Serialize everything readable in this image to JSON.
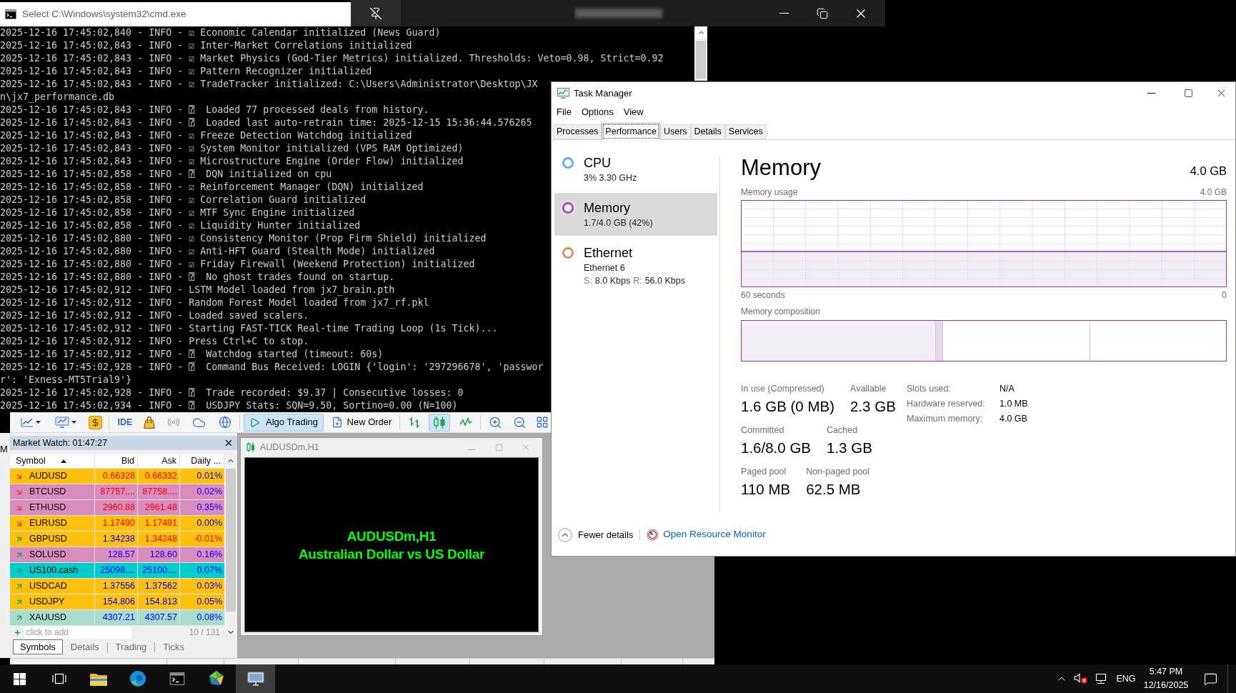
{
  "console": {
    "title": "Select C:\\Windows\\system32\\cmd.exe",
    "lines": [
      "2025-12-16 17:45:02,840 - INFO - ☑ Economic Calendar initialized (News Guard)",
      "2025-12-16 17:45:02,843 - INFO - ☑ Inter-Market Correlations initialized",
      "2025-12-16 17:45:02,843 - INFO - ☑ Market Physics (God-Tier Metrics) initialized. Thresholds: Veto=0.98, Strict=0.92",
      "2025-12-16 17:45:02,843 - INFO - ☑ Pattern Recognizer initialized",
      "2025-12-16 17:45:02,843 - INFO - ☑ TradeTracker initialized: C:\\Users\\Administrator\\Desktop\\JX",
      "n\\jx7_performance.db",
      "2025-12-16 17:45:02,843 - INFO - ⍰  Loaded 77 processed deals from history.",
      "2025-12-16 17:45:02,843 - INFO - ⍰  Loaded last auto-retrain time: 2025-12-15 15:36:44.576265",
      "2025-12-16 17:45:02,843 - INFO - ☑ Freeze Detection Watchdog initialized",
      "2025-12-16 17:45:02,843 - INFO - ☑ System Monitor initialized (VPS RAM Optimized)",
      "2025-12-16 17:45:02,843 - INFO - ☑ Microstructure Engine (Order Flow) initialized",
      "2025-12-16 17:45:02,858 - INFO - ⍰  DQN initialized on cpu",
      "2025-12-16 17:45:02,858 - INFO - ☑ Reinforcement Manager (DQN) initialized",
      "2025-12-16 17:45:02,858 - INFO - ☑ Correlation Guard initialized",
      "2025-12-16 17:45:02,858 - INFO - ☑ MTF Sync Engine initialized",
      "2025-12-16 17:45:02,858 - INFO - ☑ Liquidity Hunter initialized",
      "2025-12-16 17:45:02,880 - INFO - ☑ Consistency Monitor (Prop Firm Shield) initialized",
      "2025-12-16 17:45:02,880 - INFO - ☑ Anti-HFT Guard (Stealth Mode) initialized",
      "2025-12-16 17:45:02,880 - INFO - ☑ Friday Firewall (Weekend Protection) initialized",
      "2025-12-16 17:45:02,880 - INFO - ⍰  No ghost trades found on startup.",
      "2025-12-16 17:45:02,912 - INFO - LSTM Model loaded from jx7_brain.pth",
      "2025-12-16 17:45:02,912 - INFO - Random Forest Model loaded from jx7_rf.pkl",
      "2025-12-16 17:45:02,912 - INFO - Loaded saved scalers.",
      "2025-12-16 17:45:02,912 - INFO - Starting FAST-TICK Real-time Trading Loop (1s Tick)...",
      "2025-12-16 17:45:02,912 - INFO - Press Ctrl+C to stop.",
      "2025-12-16 17:45:02,912 - INFO - ⍰  Watchdog started (timeout: 60s)",
      "2025-12-16 17:45:02,928 - INFO - ⍰  Command Bus Received: LOGIN {'login': '297296678', 'passwor",
      "r': 'Exness-MT5Trial9'}",
      "2025-12-16 17:45:02,928 - INFO - ⍰  Trade recorded: $9.37 | Consecutive losses: 0",
      "2025-12-16 17:45:02,934 - INFO - ⍰  USDJPY Stats: SQN=9.50, Sortino=0.00 (N=100)"
    ]
  },
  "side_panel": {
    "text": "M"
  },
  "mt5": {
    "toolbar": {
      "ide": "IDE",
      "algo_trading": {
        "label": "Algo Trading",
        "on": true
      },
      "new_order": "New Order",
      "chart_types": [
        {
          "kind": "bars",
          "selected": false
        },
        {
          "kind": "candles",
          "selected": true
        },
        {
          "kind": "line",
          "selected": false
        }
      ]
    },
    "market_watch": {
      "title": "Market Watch: 01:47:27",
      "columns": [
        {
          "label": "Symbol",
          "sorted": true
        },
        {
          "label": "Bid",
          "sorted": false
        },
        {
          "label": "Ask",
          "sorted": false
        },
        {
          "label": "Daily ...",
          "sorted": false
        }
      ],
      "rows": [
        {
          "symbol": "AUDUSD",
          "rising": false,
          "bid": "0.66328",
          "bid_rising": false,
          "ask": "0.66332",
          "ask_rising": false,
          "daily": "0.01%",
          "daily_rising": true,
          "color": "#ffc10e"
        },
        {
          "symbol": "BTCUSD",
          "rising": false,
          "bid": "87757....",
          "bid_rising": false,
          "ask": "87758....",
          "ask_rising": false,
          "daily": "0.02%",
          "daily_rising": true,
          "color": "#da8cbe"
        },
        {
          "symbol": "ETHUSD",
          "rising": false,
          "bid": "2960.88",
          "bid_rising": false,
          "ask": "2961.48",
          "ask_rising": false,
          "daily": "0.35%",
          "daily_rising": true,
          "color": "#da8cbe"
        },
        {
          "symbol": "EURUSD",
          "rising": false,
          "bid": "1.17490",
          "bid_rising": false,
          "ask": "1.17491",
          "ask_rising": false,
          "daily": "0.00%",
          "daily_rising": true,
          "color": "#ffc10e"
        },
        {
          "symbol": "GBPUSD",
          "rising": true,
          "bid": "1.34238",
          "bid_rising": true,
          "ask": "1.34248",
          "ask_rising": false,
          "daily": "-0.01%",
          "daily_rising": false,
          "color": "#ffc10e"
        },
        {
          "symbol": "SOLUSD",
          "rising": true,
          "bid": "128.57",
          "bid_rising": true,
          "ask": "128.60",
          "ask_rising": true,
          "daily": "0.16%",
          "daily_rising": true,
          "color": "#da8cbe"
        },
        {
          "symbol": "US100.cash",
          "rising": true,
          "bid": "25098....",
          "bid_rising": true,
          "ask": "25100....",
          "ask_rising": true,
          "daily": "0.07%",
          "daily_rising": true,
          "color": "#00cccc"
        },
        {
          "symbol": "USDCAD",
          "rising": true,
          "bid": "1.37556",
          "bid_rising": true,
          "ask": "1.37562",
          "ask_rising": true,
          "daily": "0.03%",
          "daily_rising": true,
          "color": "#ffc10e"
        },
        {
          "symbol": "USDJPY",
          "rising": true,
          "bid": "154.806",
          "bid_rising": true,
          "ask": "154.813",
          "ask_rising": true,
          "daily": "0.05%",
          "daily_rising": true,
          "color": "#ffc10e"
        },
        {
          "symbol": "XAUUSD",
          "rising": true,
          "bid": "4307.21",
          "bid_rising": true,
          "ask": "4307.57",
          "ask_rising": true,
          "daily": "0.08%",
          "daily_rising": true,
          "color": "#aadccd"
        }
      ],
      "add_row": {
        "placeholder": "click to add",
        "count": "10 / 131"
      },
      "tabs": [
        {
          "label": "Symbols",
          "selected": true
        },
        {
          "label": "Details",
          "selected": false
        },
        {
          "label": "Trading",
          "selected": false
        },
        {
          "label": "Ticks",
          "selected": false
        }
      ]
    },
    "chart_window": {
      "title": "AUDUSDm,H1",
      "symbol": "AUDUSDm,H1",
      "description": "Australian Dollar vs US Dollar"
    }
  },
  "task_manager": {
    "title": "Task Manager",
    "menu": [
      "File",
      "Options",
      "View"
    ],
    "tabs": [
      {
        "label": "Processes",
        "selected": false
      },
      {
        "label": "Performance",
        "selected": true
      },
      {
        "label": "Users",
        "selected": false
      },
      {
        "label": "Details",
        "selected": false
      },
      {
        "label": "Services",
        "selected": false
      }
    ],
    "resources": [
      {
        "name": "CPU",
        "detail": "3% 3.30 GHz",
        "color": "#5ba7e8",
        "selected": false
      },
      {
        "name": "Memory",
        "detail": "1.7/4.0 GB (42%)",
        "color": "#a43fc8",
        "selected": true
      },
      {
        "name": "Ethernet",
        "detail": "Ethernet 6",
        "rates": [
          {
            "label": "S:",
            "value": "8.0 Kbps"
          },
          {
            "label": "R:",
            "value": "56.0 Kbps"
          }
        ],
        "color": "#d6894f",
        "selected": false
      }
    ],
    "panel": {
      "title": "Memory",
      "capacity": "4.0 GB",
      "usage_graph": {
        "label": "Memory usage",
        "max": "4.0 GB",
        "span": "60 seconds",
        "min": "0"
      },
      "composition_label": "Memory composition",
      "stat_rows": [
        {
          "items": [
            {
              "label": "In use (Compressed)",
              "value": "1.6 GB (0 MB)"
            },
            {
              "label": "Available",
              "value": "2.3 GB"
            }
          ]
        },
        {
          "items": [
            {
              "label": "Committed",
              "value": "1.6/8.0 GB"
            },
            {
              "label": "Cached",
              "value": "1.3 GB"
            }
          ]
        },
        {
          "items": [
            {
              "label": "Paged pool",
              "value": "110 MB"
            },
            {
              "label": "Non-paged pool",
              "value": "62.5 MB"
            }
          ]
        }
      ],
      "properties": [
        {
          "label": "Slots used:",
          "value": "N/A"
        },
        {
          "label": "Hardware reserved:",
          "value": "1.0 MB"
        },
        {
          "label": "Maximum memory:",
          "value": "4.0 GB"
        }
      ]
    },
    "footer": {
      "toggle": "Fewer details",
      "link": "Open Resource Monitor"
    }
  },
  "taskbar": {
    "apps": [
      {
        "kind": "start",
        "active": false
      },
      {
        "kind": "task_view",
        "active": false
      },
      {
        "kind": "file_explorer",
        "active": false
      },
      {
        "kind": "browser",
        "active": false
      },
      {
        "kind": "terminal",
        "active": false
      },
      {
        "kind": "trading",
        "active": false
      },
      {
        "kind": "remote_desktop",
        "active": true
      }
    ],
    "tray": {
      "language": "ENG",
      "time": "5:47 PM",
      "date": "12/16/2025"
    }
  }
}
